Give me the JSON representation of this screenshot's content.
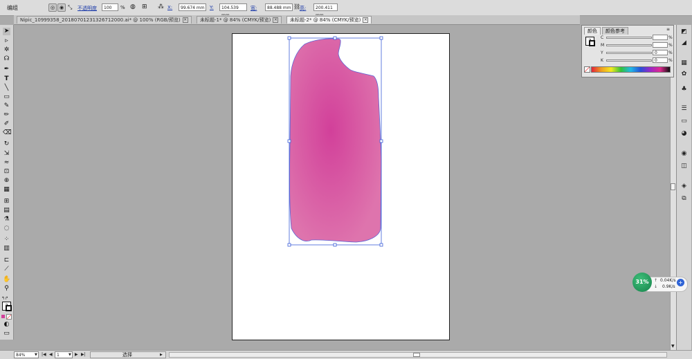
{
  "control_bar": {
    "mode_label": "编组",
    "opacity_label": "不透明度",
    "opacity_value": "100",
    "opacity_unit": "%",
    "x_label": "X:",
    "x_value": "99.674 mm",
    "y_label": "Y:",
    "y_value": "104.539 mm",
    "w_label": "宽:",
    "w_value": "88.488 mm",
    "h_label": "高:",
    "h_value": "200.411 mm"
  },
  "tabs": [
    {
      "label": "Nipic_10999358_20180701231326712000.ai* @ 100% (RGB/预览)",
      "active": false
    },
    {
      "label": "未标题-1* @ 84% (CMYK/预览)",
      "active": false
    },
    {
      "label": "未标题-2* @ 84% (CMYK/预览)",
      "active": true
    }
  ],
  "color_panel": {
    "tabs": [
      "颜色",
      "颜色参考"
    ],
    "rows": [
      {
        "channel": "C",
        "value": "",
        "unit": "%"
      },
      {
        "channel": "M",
        "value": "",
        "unit": "%"
      },
      {
        "channel": "Y",
        "value": "0",
        "unit": "%"
      },
      {
        "channel": "K",
        "value": "0",
        "unit": "%"
      }
    ]
  },
  "status": {
    "zoom": "84%",
    "page": "1",
    "tool": "选择"
  },
  "network_widget": {
    "percent": "31%",
    "upload": "0.04K/s",
    "download": "0.9K/s"
  },
  "colors": {
    "shape_fill_center": "#d2409a",
    "shape_fill_edge": "#dc70ab",
    "selection": "#3a5cd8"
  }
}
